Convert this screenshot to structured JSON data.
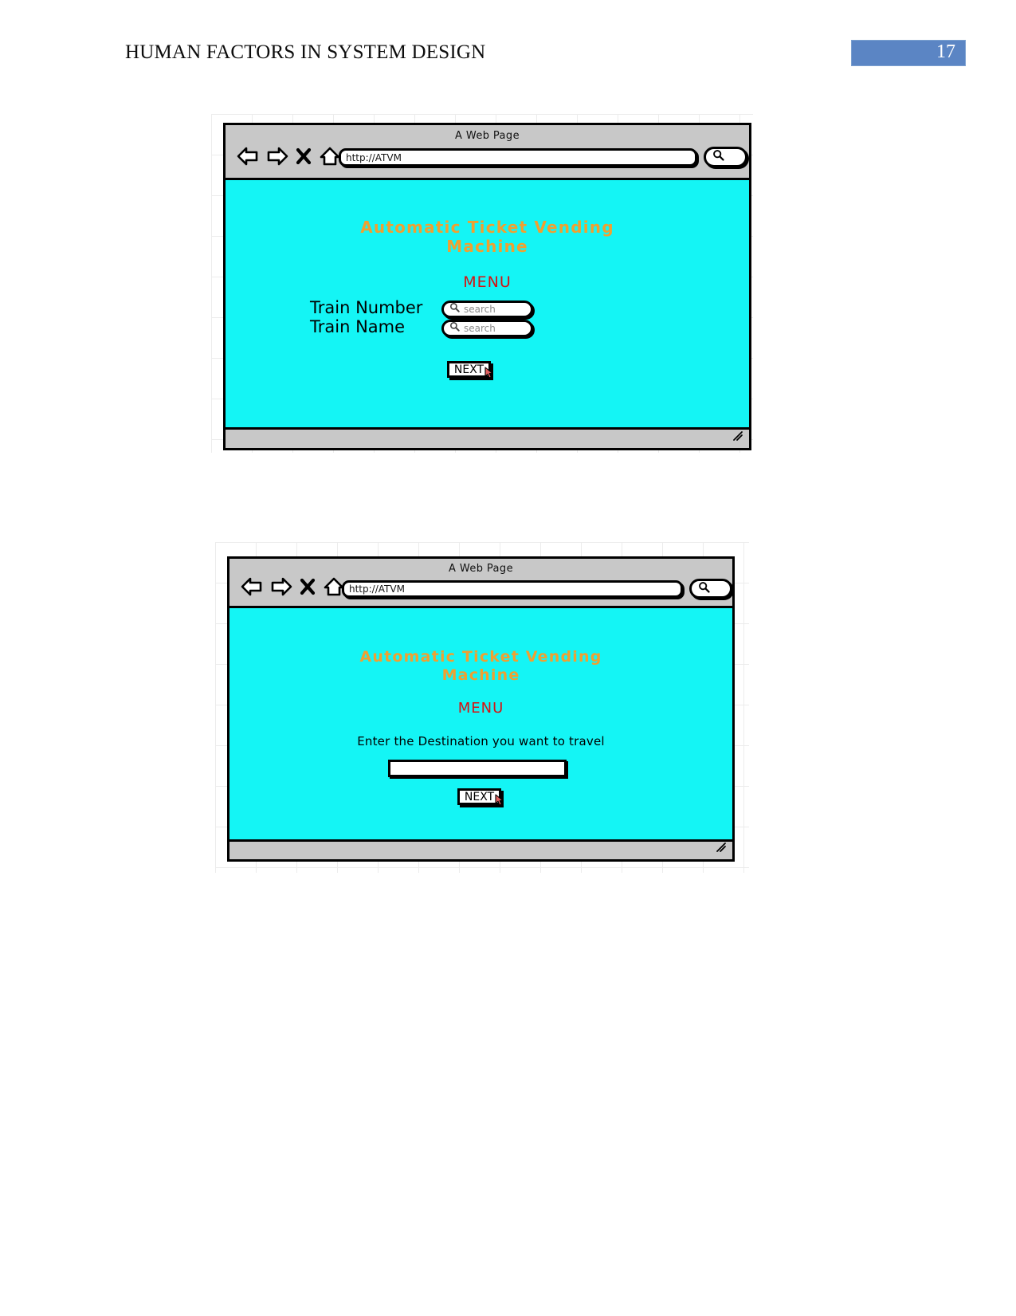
{
  "document": {
    "header_title": "HUMAN FACTORS IN SYSTEM DESIGN",
    "page_number": "17",
    "badge_color": "#5b85c4"
  },
  "colors": {
    "screen_background": "#14f5f5",
    "title_orange": "#f0a030",
    "menu_red": "#d61212",
    "chrome_gray": "#c8c8c8",
    "cursor_red": "#e06060"
  },
  "mockups": [
    {
      "window_title": "A Web Page",
      "url": "http://ATVM",
      "toolbar_icons": [
        "back-arrow-icon",
        "forward-arrow-icon",
        "close-x-icon",
        "home-icon"
      ],
      "chrome_search_icon": "magnifier-icon",
      "screen": {
        "app_title": "Automatic Ticket Vending Machine",
        "app_title_line1": "Automatic Ticket Vending",
        "app_title_line2": "Machine",
        "menu_label": "MENU",
        "fields": [
          {
            "label": "Train Number",
            "placeholder": "search",
            "value": "",
            "icon": "magnifier-icon"
          },
          {
            "label": "Train Name",
            "placeholder": "search",
            "value": "",
            "icon": "magnifier-icon"
          }
        ],
        "next_label": "NEXT"
      }
    },
    {
      "window_title": "A Web Page",
      "url": "http://ATVM",
      "toolbar_icons": [
        "back-arrow-icon",
        "forward-arrow-icon",
        "close-x-icon",
        "home-icon"
      ],
      "chrome_search_icon": "magnifier-icon",
      "screen": {
        "app_title": "Automatic Ticket Vending Machine",
        "app_title_line1": "Automatic Ticket Vending",
        "app_title_line2": "Machine",
        "menu_label": "MENU",
        "instruction": "Enter the Destination you want to travel",
        "destination_value": "",
        "next_label": "NEXT"
      }
    }
  ]
}
